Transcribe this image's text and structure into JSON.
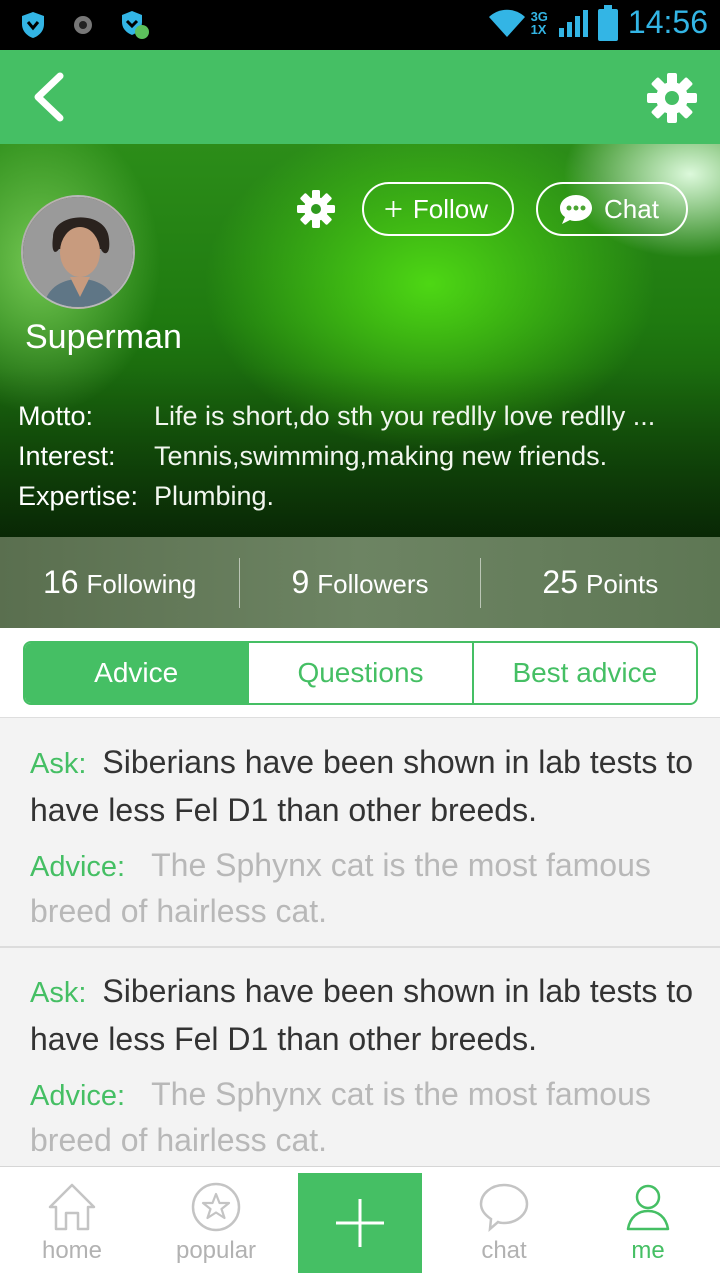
{
  "status_bar": {
    "time": "14:56",
    "network": "3G",
    "network_sub": "1X"
  },
  "app_bar": {
    "back_icon": "chevron-left-icon",
    "settings_icon": "gear-icon"
  },
  "profile": {
    "name": "Superman",
    "follow_label": "Follow",
    "chat_label": "Chat",
    "info": [
      {
        "label": "Motto:",
        "value": "Life is short,do sth you redlly love redlly ..."
      },
      {
        "label": "Interest:",
        "value": "Tennis,swimming,making new friends."
      },
      {
        "label": "Expertise:",
        "value": "Plumbing."
      }
    ]
  },
  "stats": [
    {
      "count": "16",
      "label": "Following"
    },
    {
      "count": "9",
      "label": "Followers"
    },
    {
      "count": "25",
      "label": "Points"
    }
  ],
  "tabs": [
    {
      "label": "Advice",
      "active": true
    },
    {
      "label": "Questions",
      "active": false
    },
    {
      "label": "Best advice",
      "active": false
    }
  ],
  "feed": [
    {
      "ask_key": "Ask:",
      "ask": "Siberians have been shown in lab tests to have less Fel D1 than other breeds.",
      "advice_key": "Advice:",
      "advice": "The Sphynx cat is the most famous breed of hairless cat."
    },
    {
      "ask_key": "Ask:",
      "ask": "Siberians have been shown in lab tests to have less Fel D1 than other breeds.",
      "advice_key": "Advice:",
      "advice": "The Sphynx cat is the most famous breed of hairless cat."
    }
  ],
  "bottom_nav": [
    {
      "label": "home",
      "icon": "home-icon"
    },
    {
      "label": "popular",
      "icon": "star-icon"
    },
    {
      "label": "",
      "icon": "plus-icon"
    },
    {
      "label": "chat",
      "icon": "chat-bubble-icon"
    },
    {
      "label": "me",
      "icon": "person-icon",
      "active": true
    }
  ],
  "colors": {
    "accent": "#45bf64",
    "status_blue": "#33b5e5"
  }
}
